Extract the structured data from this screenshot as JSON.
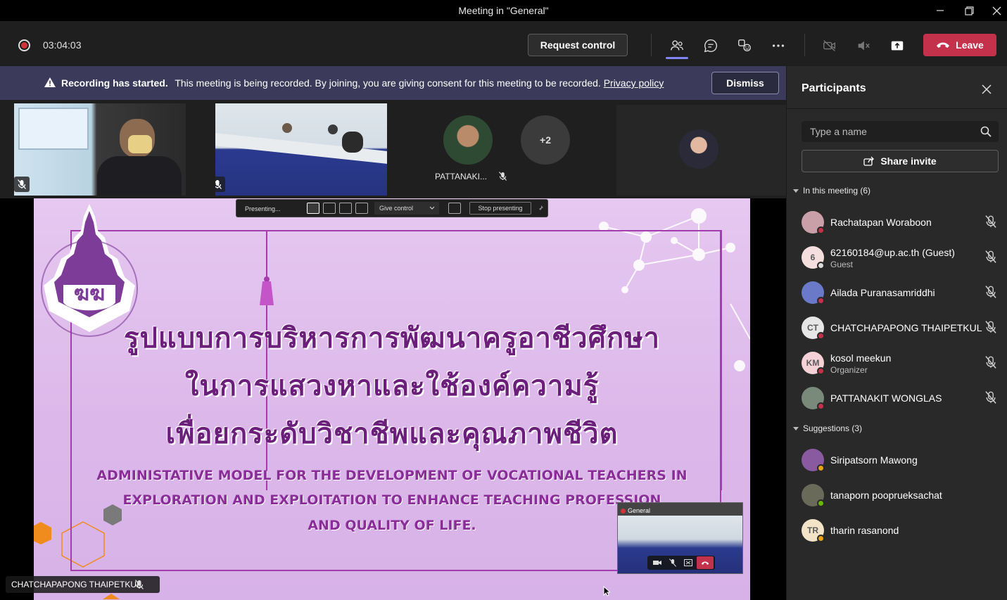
{
  "window": {
    "title": "Meeting in \"General\""
  },
  "toolbar": {
    "timer": "03:04:03",
    "request_control_label": "Request control",
    "leave_label": "Leave"
  },
  "banner": {
    "title": "Recording has started.",
    "message": "This meeting is being recorded. By joining, you are giving consent for this meeting to be recorded.",
    "link": "Privacy policy",
    "dismiss_label": "Dismiss"
  },
  "strip": {
    "more_count": "+2",
    "participant_name": "PATTANAKI..."
  },
  "slide": {
    "thai_line1": "รูปแบบการบริหารการพัฒนาครูอาชีวศึกษา",
    "thai_line2": "ในการแสวงหาและใช้องค์ความรู้",
    "thai_line3": "เพื่อยกระดับวิชาชีพและคุณภาพชีวิต",
    "eng_line1": "ADMINISTATIVE MODEL FOR THE DEVELOPMENT OF VOCATIONAL TEACHERS IN",
    "eng_line2": "EXPLORATION AND EXPLOITATION TO  ENHANCE TEACHING PROFESSION",
    "eng_line3": "AND QUALITY OF LIFE."
  },
  "presenting_bar": {
    "presenting_label": "Presenting...",
    "give_control_label": "Give control",
    "stop_label": "Stop presenting"
  },
  "mini_window": {
    "label": "General"
  },
  "speaker": {
    "name": "CHATCHAPAPONG THAIPETKUL"
  },
  "panel": {
    "title": "Participants",
    "search_placeholder": "Type a name",
    "share_invite_label": "Share invite",
    "in_meeting_label": "In this meeting (6)",
    "suggestions_label": "Suggestions (3)",
    "in_meeting": [
      {
        "name": "Rachatapan Woraboon",
        "sub": "",
        "initials": "",
        "status_color": "#c4314b",
        "avatar_color": "#caa0a8"
      },
      {
        "name": "62160184@up.ac.th (Guest)",
        "sub": "Guest",
        "initials": "6",
        "status_color": "#dcdcdc",
        "avatar_color": "#f5dede"
      },
      {
        "name": "Ailada Puranasamriddhi",
        "sub": "",
        "initials": "",
        "status_color": "#c4314b",
        "avatar_color": "#6a7ac9"
      },
      {
        "name": "CHATCHAPAPONG THAIPETKUL",
        "sub": "",
        "initials": "CT",
        "status_color": "#c4314b",
        "avatar_color": "#e6e6e6"
      },
      {
        "name": "kosol meekun",
        "sub": "Organizer",
        "initials": "KM",
        "status_color": "#c4314b",
        "avatar_color": "#f4d2d6"
      },
      {
        "name": "PATTANAKIT WONGLAS",
        "sub": "",
        "initials": "",
        "status_color": "#c4314b",
        "avatar_color": "#7a8a7a"
      }
    ],
    "suggestions": [
      {
        "name": "Siripatsorn Mawong",
        "initials": "",
        "status_color": "#e8a317",
        "avatar_color": "#8a5aa0"
      },
      {
        "name": "tanaporn pooprueksachat",
        "initials": "",
        "status_color": "#6bb700",
        "avatar_color": "#6a6a5a"
      },
      {
        "name": "tharin rasanond",
        "initials": "TR",
        "status_color": "#e8a317",
        "avatar_color": "#f3e4c8"
      }
    ]
  }
}
